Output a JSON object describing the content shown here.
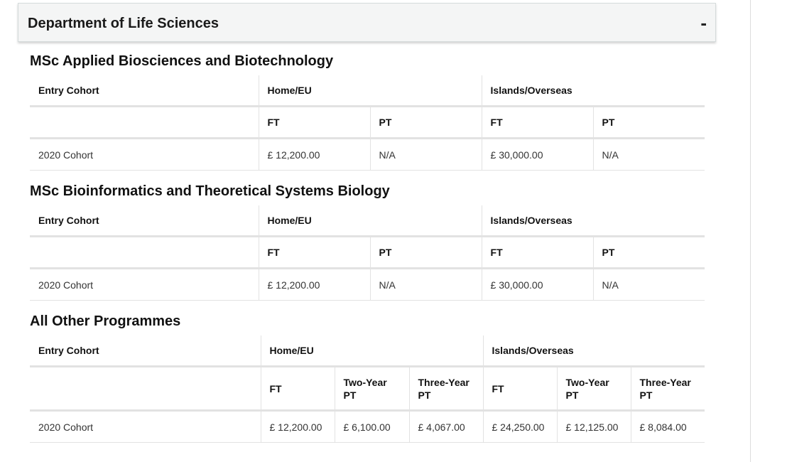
{
  "department": {
    "title": "Department of Life Sciences",
    "toggle_symbol": "-"
  },
  "programmes": [
    {
      "title": "MSc Applied Biosciences and Biotechnology",
      "headers": {
        "entry_cohort": "Entry Cohort",
        "home": "Home/EU",
        "overseas": "Islands/Overseas"
      },
      "subheaders": [
        "FT",
        "PT",
        "FT",
        "PT"
      ],
      "rows": [
        {
          "cohort": "2020 Cohort",
          "values": [
            "£ 12,200.00",
            "N/A",
            "£ 30,000.00",
            "N/A"
          ]
        }
      ]
    },
    {
      "title": "MSc Bioinformatics and Theoretical Systems Biology",
      "headers": {
        "entry_cohort": "Entry Cohort",
        "home": "Home/EU",
        "overseas": "Islands/Overseas"
      },
      "subheaders": [
        "FT",
        "PT",
        "FT",
        "PT"
      ],
      "rows": [
        {
          "cohort": "2020 Cohort",
          "values": [
            "£ 12,200.00",
            "N/A",
            "£ 30,000.00",
            "N/A"
          ]
        }
      ]
    },
    {
      "title": "All Other Programmes",
      "headers": {
        "entry_cohort": "Entry Cohort",
        "home": "Home/EU",
        "overseas": "Islands/Overseas"
      },
      "subheaders": [
        "FT",
        "Two-Year PT",
        "Three-Year PT",
        "FT",
        "Two-Year PT",
        "Three-Year PT"
      ],
      "rows": [
        {
          "cohort": "2020 Cohort",
          "values": [
            "£ 12,200.00",
            "£ 6,100.00",
            "£ 4,067.00",
            "£ 24,250.00",
            "£ 12,125.00",
            "£ 8,084.00"
          ]
        }
      ]
    }
  ]
}
